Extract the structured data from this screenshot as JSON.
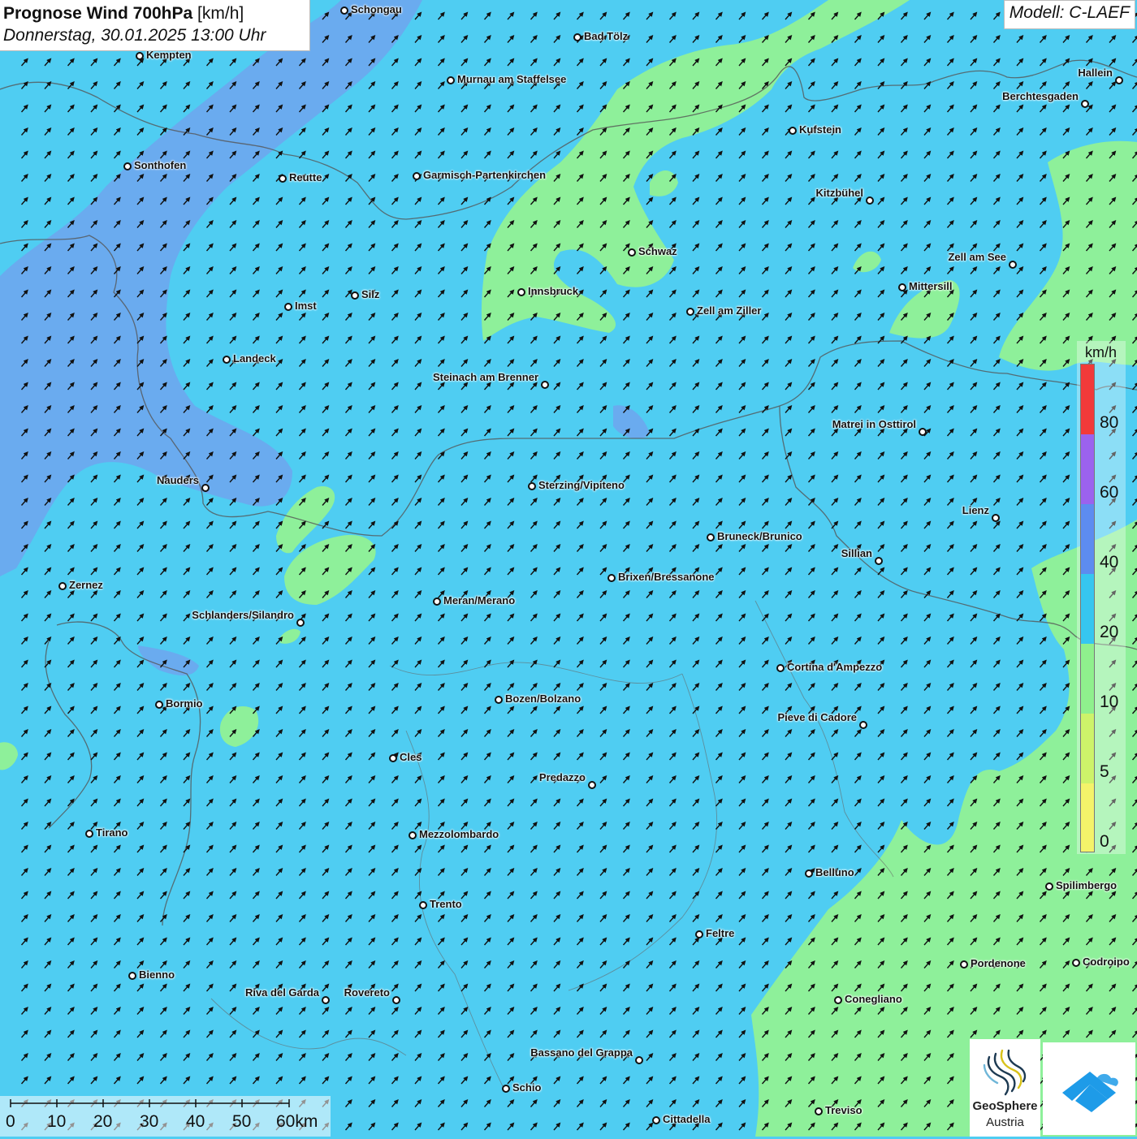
{
  "header": {
    "title_bold": "Prognose Wind 700hPa",
    "title_unit": "[km/h]",
    "subtitle": "Donnerstag, 30.01.2025 13:00 Uhr",
    "model": "Modell: C-LAEF"
  },
  "legend": {
    "unit": "km/h",
    "ticks": [
      "80",
      "60",
      "40",
      "20",
      "10",
      "5",
      "0"
    ],
    "colors": {
      "0-5": "#f4f36a",
      "5-10": "#cdf36a",
      "10-20": "#8ff08d",
      "20-40": "#36c6f0",
      "40-60": "#5d8cf0",
      "60-80": "#9b62ee",
      "80+": "#f23a3a"
    }
  },
  "scale_bar": {
    "labels": [
      "0",
      "10",
      "20",
      "30",
      "40",
      "50",
      "60km"
    ]
  },
  "logos": {
    "geosphere_line1": "GeoSphere",
    "geosphere_line2": "Austria"
  },
  "wind_direction": "south-west wind, arrows pointing north-east",
  "cities": [
    {
      "name": "Schongau"
    },
    {
      "name": "Bad Tölz"
    },
    {
      "name": "Kempten"
    },
    {
      "name": "Murnau am Staffelsee"
    },
    {
      "name": "Hallein"
    },
    {
      "name": "Berchtesgaden"
    },
    {
      "name": "Kufstein"
    },
    {
      "name": "Sonthofen"
    },
    {
      "name": "Reutte"
    },
    {
      "name": "Garmisch-Partenkirchen"
    },
    {
      "name": "Kitzbühel"
    },
    {
      "name": "Schwaz"
    },
    {
      "name": "Zell am See"
    },
    {
      "name": "Mittersill"
    },
    {
      "name": "Innsbruck"
    },
    {
      "name": "Silz"
    },
    {
      "name": "Imst"
    },
    {
      "name": "Zell am Ziller"
    },
    {
      "name": "Landeck"
    },
    {
      "name": "Steinach am Brenner"
    },
    {
      "name": "Matrei in Osttirol"
    },
    {
      "name": "Nauders"
    },
    {
      "name": "Sterzing/Vipiteno"
    },
    {
      "name": "Lienz"
    },
    {
      "name": "Bruneck/Brunico"
    },
    {
      "name": "Sillian"
    },
    {
      "name": "Zernez"
    },
    {
      "name": "Brixen/Bressanone"
    },
    {
      "name": "Meran/Merano"
    },
    {
      "name": "Schlanders/Silandro"
    },
    {
      "name": "Cortina d'Ampezzo"
    },
    {
      "name": "Bormio"
    },
    {
      "name": "Bozen/Bolzano"
    },
    {
      "name": "Pieve di Cadore"
    },
    {
      "name": "Cles"
    },
    {
      "name": "Predazzo"
    },
    {
      "name": "Tirano"
    },
    {
      "name": "Mezzolombardo"
    },
    {
      "name": "Belluno"
    },
    {
      "name": "Spilimbergo"
    },
    {
      "name": "Trento"
    },
    {
      "name": "Feltre"
    },
    {
      "name": "Pordenone"
    },
    {
      "name": "Codroipo"
    },
    {
      "name": "Bienno"
    },
    {
      "name": "Riva del Garda"
    },
    {
      "name": "Rovereto"
    },
    {
      "name": "Conegliano"
    },
    {
      "name": "Bassano del Grappa"
    },
    {
      "name": "Schio"
    },
    {
      "name": "Treviso"
    },
    {
      "name": "Cittadella"
    }
  ]
}
